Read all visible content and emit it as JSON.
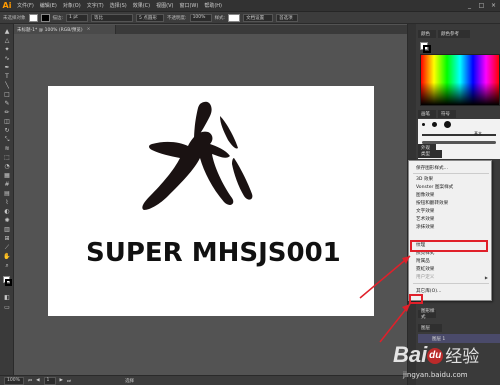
{
  "app": {
    "logo": "Ai"
  },
  "menubar": [
    "文件(F)",
    "编辑(E)",
    "对象(O)",
    "文字(T)",
    "选择(S)",
    "效果(C)",
    "视图(V)",
    "窗口(W)",
    "帮助(H)"
  ],
  "window_controls": [
    "_",
    "□",
    "×"
  ],
  "controlbar": {
    "selection_label": "未选择对象",
    "stroke_label": "描边:",
    "stroke_value": "1 pt",
    "stroke_style": "等比",
    "brush_value": "5 点圆形",
    "opacity_label": "不透明度:",
    "opacity_value": "100%",
    "style_label": "样式:",
    "doc_setup_label": "文档设置",
    "prefs_label": "首选项",
    "fill_color": "#ffffff",
    "stroke_color": "#000000"
  },
  "document_tab": {
    "title": "未标题-1* @ 100% (RGB/预览)",
    "close": "×"
  },
  "artboard": {
    "text": "SUPER MHSJS001"
  },
  "statusbar": {
    "zoom": "100%",
    "page": "1",
    "mode": "选择"
  },
  "panels": {
    "color_tab": "颜色",
    "color_guide_tab": "颜色参考",
    "brushes_tab": "画笔",
    "symbols_tab": "符号",
    "stroke_weight": "5.00",
    "basic_label": "基本",
    "appearance_tab": "外观",
    "type_tab": "类型",
    "layers_tab": "图层",
    "layer_label": "图层 1",
    "graphic_styles_tab": "图形样式"
  },
  "context_menu": {
    "items": [
      {
        "label": "保存图形样式...",
        "disabled": false,
        "submenu": false
      },
      {
        "label": "3D 效果",
        "disabled": false,
        "submenu": false
      },
      {
        "label": "Vonster 图案样式",
        "disabled": false,
        "submenu": false
      },
      {
        "label": "图像效果",
        "disabled": false,
        "submenu": false
      },
      {
        "label": "按钮和翻转效果",
        "disabled": false,
        "submenu": false
      },
      {
        "label": "文字效果",
        "disabled": false,
        "submenu": false
      },
      {
        "label": "艺术效果",
        "disabled": false,
        "submenu": false
      },
      {
        "label": "涂抹效果",
        "disabled": false,
        "submenu": false
      },
      {
        "label": "纹理",
        "disabled": false,
        "submenu": false
      },
      {
        "label": "照亮样式",
        "disabled": false,
        "submenu": false
      },
      {
        "label": "附属品",
        "disabled": false,
        "submenu": false
      },
      {
        "label": "霓虹效果",
        "disabled": false,
        "submenu": false
      },
      {
        "label": "用户定义",
        "disabled": true,
        "submenu": true
      },
      {
        "label": "其它库(O)...",
        "disabled": false,
        "submenu": false
      }
    ]
  },
  "watermark": {
    "brand": "Bai",
    "paw": "du",
    "suffix": "经验",
    "url": "jingyan.baidu.com"
  },
  "colors": {
    "highlight": "#e0202a",
    "panel_bg": "#3a3a3a",
    "app_bg": "#535353"
  }
}
